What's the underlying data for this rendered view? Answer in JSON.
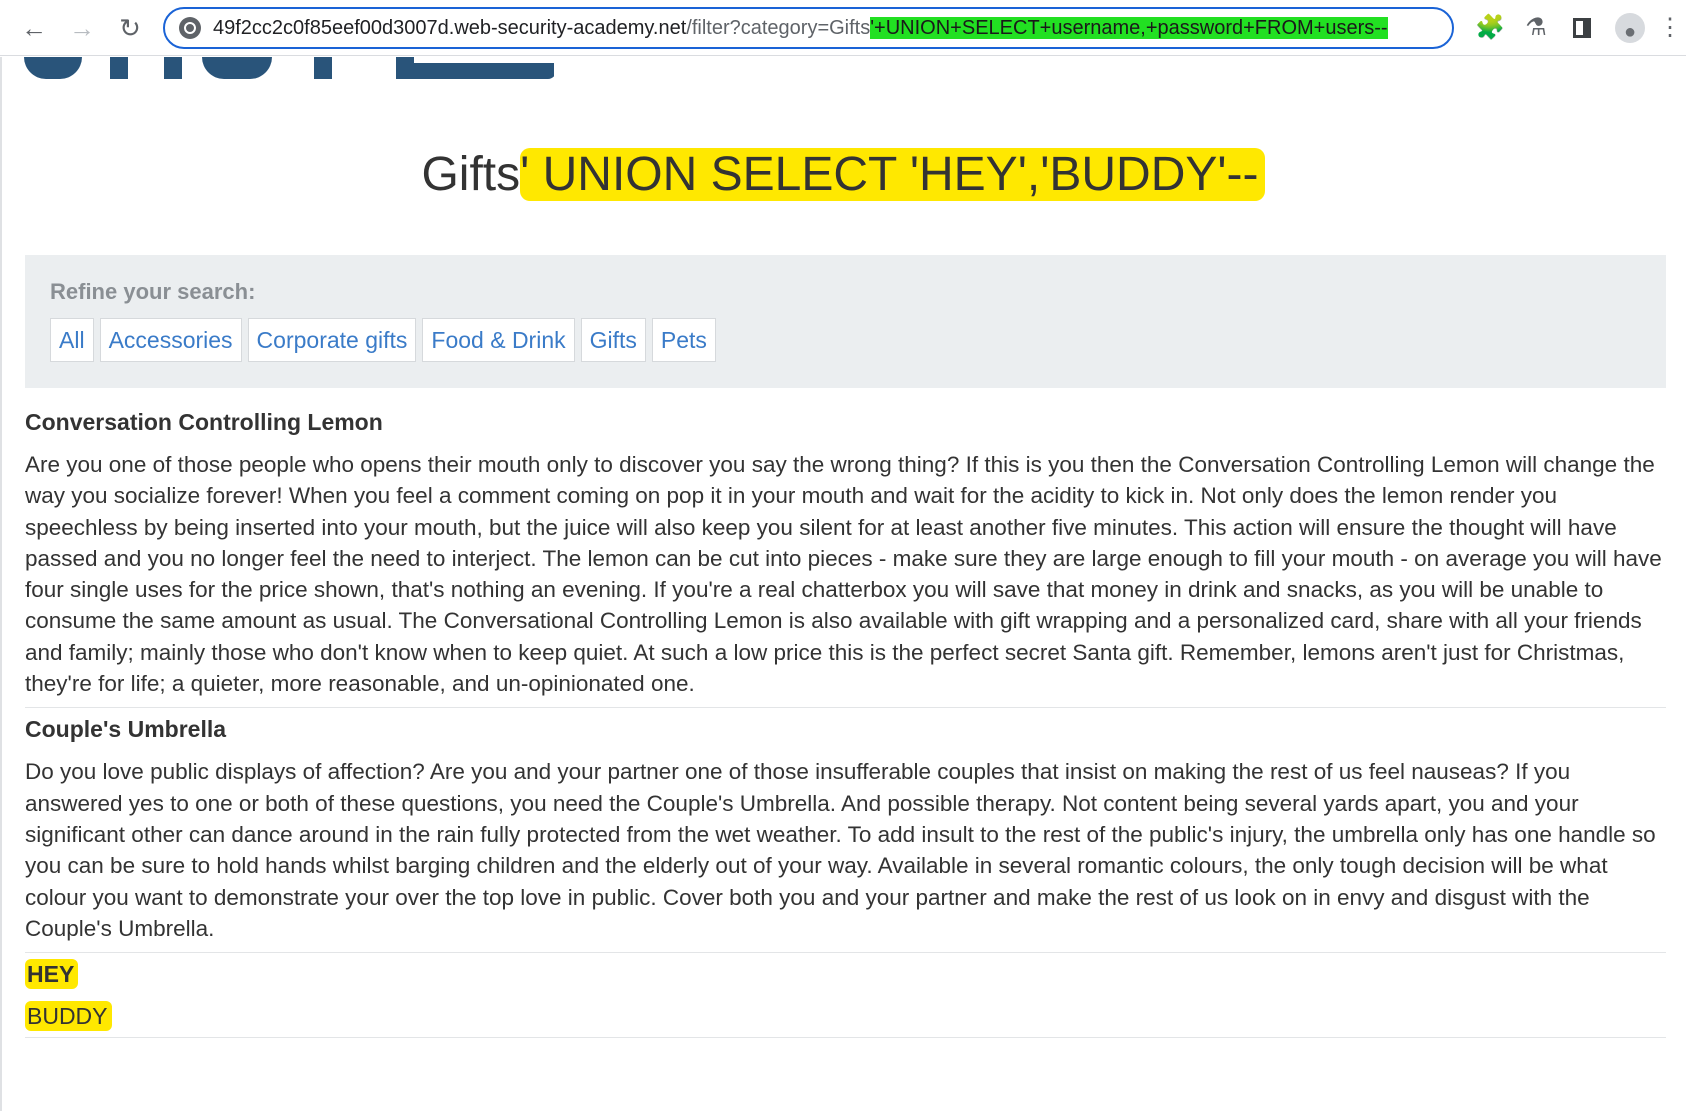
{
  "browser": {
    "url_host": "49f2cc2c0f85eef00d3007d.web-security-academy.net",
    "url_path": "/filter?category=Gifts",
    "url_injection": "'+UNION+SELECT+username,+password+FROM+users--",
    "highlight_color": "#22e022",
    "icons": [
      "back-arrow-icon",
      "forward-arrow-icon",
      "reload-icon",
      "site-info-icon",
      "extensions-icon",
      "labs-flask-icon",
      "side-panel-icon",
      "profile-icon",
      "menu-icon"
    ]
  },
  "page": {
    "heading_prefix": "Gifts",
    "heading_injected": "' UNION SELECT 'HEY','BUDDY'--",
    "highlight_color": "#ffe800",
    "refine_label": "Refine your search:",
    "categories": [
      "All",
      "Accessories",
      "Corporate gifts",
      "Food & Drink",
      "Gifts",
      "Pets"
    ],
    "products": [
      {
        "title": "Conversation Controlling Lemon",
        "description": "Are you one of those people who opens their mouth only to discover you say the wrong thing? If this is you then the Conversation Controlling Lemon will change the way you socialize forever! When you feel a comment coming on pop it in your mouth and wait for the acidity to kick in. Not only does the lemon render you speechless by being inserted into your mouth, but the juice will also keep you silent for at least another five minutes. This action will ensure the thought will have passed and you no longer feel the need to interject. The lemon can be cut into pieces - make sure they are large enough to fill your mouth - on average you will have four single uses for the price shown, that's nothing an evening. If you're a real chatterbox you will save that money in drink and snacks, as you will be unable to consume the same amount as usual. The Conversational Controlling Lemon is also available with gift wrapping and a personalized card, share with all your friends and family; mainly those who don't know when to keep quiet. At such a low price this is the perfect secret Santa gift. Remember, lemons aren't just for Christmas, they're for life; a quieter, more reasonable, and un-opinionated one."
      },
      {
        "title": "Couple's Umbrella",
        "description": "Do you love public displays of affection? Are you and your partner one of those insufferable couples that insist on making the rest of us feel nauseas? If you answered yes to one or both of these questions, you need the Couple's Umbrella. And possible therapy. Not content being several yards apart, you and your significant other can dance around in the rain fully protected from the wet weather. To add insult to the rest of the public's injury, the umbrella only has one handle so you can be sure to hold hands whilst barging children and the elderly out of your way. Available in several romantic colours, the only tough decision will be what colour you want to demonstrate your over the top love in public. Cover both you and your partner and make the rest of us look on in envy and disgust with the Couple's Umbrella."
      }
    ],
    "injected_rows": {
      "title": "HEY",
      "value": "BUDDY"
    }
  }
}
